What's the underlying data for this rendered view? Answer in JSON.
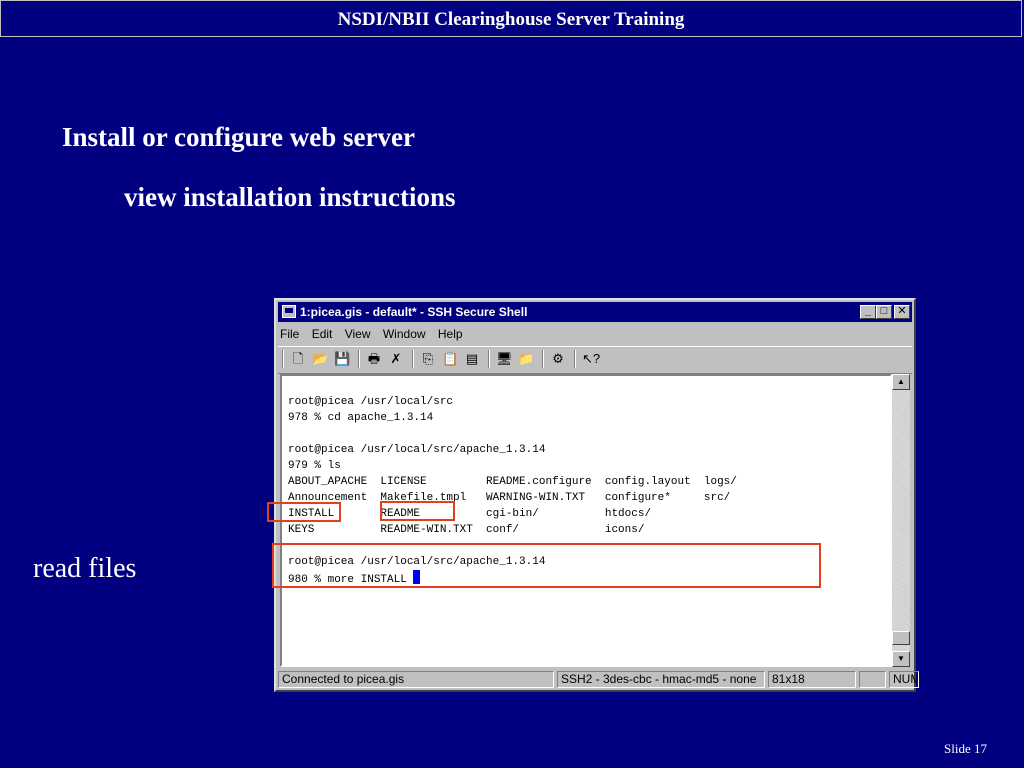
{
  "slide": {
    "header": "NSDI/NBII Clearinghouse Server Training",
    "heading": "Install or configure web server",
    "subheading": "view installation instructions",
    "side_label": "read files",
    "slide_number": "Slide 17"
  },
  "window": {
    "title": "1:picea.gis - default* - SSH Secure Shell",
    "menu": [
      {
        "label": "File"
      },
      {
        "label": "Edit"
      },
      {
        "label": "View"
      },
      {
        "label": "Window"
      },
      {
        "label": "Help"
      }
    ],
    "toolbar_icons": [
      "new-file-icon",
      "open-folder-icon",
      "save-icon",
      "print-icon",
      "disconnect-icon",
      "copy-icon",
      "paste-icon",
      "paste-alt-icon",
      "profile-icon",
      "settings-icon",
      "keys-icon",
      "help-icon"
    ],
    "terminal_lines": [
      "root@picea /usr/local/src",
      "978 % cd apache_1.3.14",
      "",
      "root@picea /usr/local/src/apache_1.3.14",
      "979 % ls",
      "ABOUT_APACHE  LICENSE         README.configure  config.layout  logs/",
      "Announcement  Makefile.tmpl   WARNING-WIN.TXT   configure*     src/",
      "INSTALL       README          cgi-bin/          htdocs/",
      "KEYS          README-WIN.TXT  conf/             icons/",
      "",
      "root@picea /usr/local/src/apache_1.3.14",
      "980 % more INSTALL "
    ],
    "status": {
      "connection": "Connected to picea.gis",
      "cipher": "SSH2 - 3des-cbc - hmac-md5 - none",
      "size": "81x18",
      "blank": "",
      "num": "NUM"
    }
  },
  "colors": {
    "slide_background": "#000080",
    "highlight_box": "#e04020",
    "cursor": "#0000ff"
  }
}
